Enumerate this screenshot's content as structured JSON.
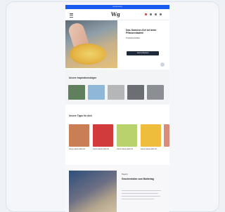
{
  "topbar": {
    "text": "••••••••  ••••••"
  },
  "header": {
    "logo": "Wg",
    "icon_colors": [
      "#d94b4b",
      "#777777",
      "#777777",
      "#777777"
    ]
  },
  "hero": {
    "title": "Das Sommer-Set ist beim Pflanzenladen!",
    "subtitle": "Tropische Farben",
    "button": "Jetzt entdecken"
  },
  "section1": {
    "title": "Unsere Inspirationsbögen",
    "thumb_colors": [
      "#5f7f5d",
      "#8fb8d8",
      "#b5b6b8",
      "#6b6e72",
      "#8b8f94"
    ]
  },
  "section2": {
    "title": "Unsere Tipps für dich",
    "cards": [
      {
        "title": "Lorem ipsum dolor sit",
        "color": "#c97e56"
      },
      {
        "title": "Lorem ipsum dolor sit",
        "color": "#d13b3b"
      },
      {
        "title": "Lorem ipsum dolor sit",
        "color": "#b8d26d"
      },
      {
        "title": "Lorem ipsum dolor sit",
        "color": "#eebd3c"
      },
      {
        "title": "Lorem ipsum",
        "color": "#d98c7a"
      }
    ]
  },
  "magazine": {
    "tag": "Magazin",
    "title": "Geschenkidee zum Muttertag"
  }
}
